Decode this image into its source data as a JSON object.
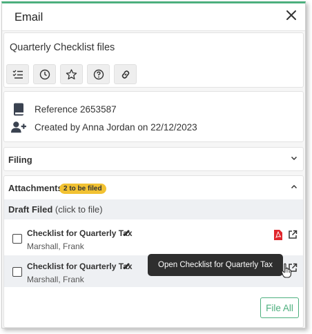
{
  "panel": {
    "title": "Email",
    "accent_color": "#4caf7d"
  },
  "subject": "Quarterly Checklist files",
  "toolbar": [
    {
      "name": "checklist-icon"
    },
    {
      "name": "clock-icon"
    },
    {
      "name": "star-icon"
    },
    {
      "name": "help-icon"
    },
    {
      "name": "link-icon"
    }
  ],
  "info": {
    "reference": "Reference 2653587",
    "created": "Created by Anna Jordan on 22/12/2023"
  },
  "filing": {
    "label": "Filing"
  },
  "attachments": {
    "label": "Attachments",
    "badge": "2 to be filed",
    "badge_color": "#f2c232",
    "draft_label": "Draft Filed",
    "draft_hint": "(click to file)",
    "items": [
      {
        "name": "Checklist for Quarterly Tax",
        "owner": "Marshall, Frank"
      },
      {
        "name": "Checklist for Quarterly Tax",
        "owner": "Marshall, Frank"
      }
    ],
    "file_all_label": "File All"
  },
  "tooltip": "Open Checklist for Quarterly Tax"
}
